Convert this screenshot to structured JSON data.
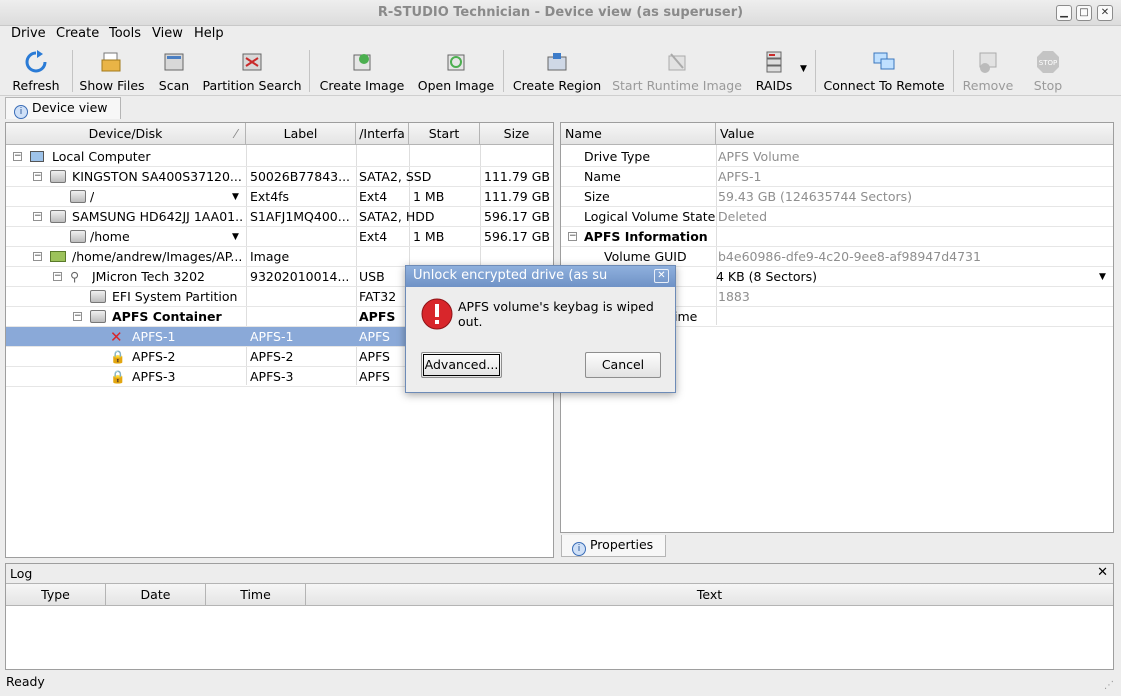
{
  "window": {
    "title": "R-STUDIO Technician - Device view (as superuser)"
  },
  "menu": [
    "Drive",
    "Create",
    "Tools",
    "View",
    "Help"
  ],
  "toolbar": {
    "refresh": "Refresh",
    "show_files": "Show Files",
    "scan": "Scan",
    "partition_search": "Partition Search",
    "create_image": "Create Image",
    "open_image": "Open Image",
    "create_region": "Create Region",
    "start_runtime_image": "Start Runtime Image",
    "raids": "RAIDs",
    "connect_to_remote": "Connect To Remote",
    "remove": "Remove",
    "stop": "Stop"
  },
  "tabs": {
    "device_view": "Device view",
    "properties": "Properties"
  },
  "device_table": {
    "columns": [
      "Device/Disk",
      "Label",
      "/Interfa",
      "Start",
      "Size"
    ],
    "rows": [
      {
        "name": "Local Computer",
        "label": "",
        "iface": "",
        "start": "",
        "size": ""
      },
      {
        "name": "KINGSTON SA400S37120...",
        "label": "50026B77843...",
        "iface": "SATA2, SSD",
        "start": "",
        "size": "111.79 GB"
      },
      {
        "name": "/",
        "label": "Ext4fs",
        "iface": "Ext4",
        "start": "1 MB",
        "size": "111.79 GB"
      },
      {
        "name": "SAMSUNG HD642JJ 1AA01...",
        "label": "S1AFJ1MQ400...",
        "iface": "SATA2, HDD",
        "start": "",
        "size": "596.17 GB"
      },
      {
        "name": "/home",
        "label": "",
        "iface": "Ext4",
        "start": "1 MB",
        "size": "596.17 GB"
      },
      {
        "name": "/home/andrew/Images/AP...",
        "label": "Image",
        "iface": "",
        "start": "",
        "size": ""
      },
      {
        "name": "JMicron Tech 3202",
        "label": "93202010014...",
        "iface": "USB",
        "start": "",
        "size": ""
      },
      {
        "name": "EFI System Partition",
        "label": "",
        "iface": "FAT32",
        "start": "",
        "size": ""
      },
      {
        "name": "APFS Container",
        "label": "",
        "iface": "APFS",
        "start": "",
        "size": ""
      },
      {
        "name": "APFS-1",
        "label": "APFS-1",
        "iface": "APFS",
        "start": "",
        "size": ""
      },
      {
        "name": "APFS-2",
        "label": "APFS-2",
        "iface": "APFS",
        "start": "",
        "size": ""
      },
      {
        "name": "APFS-3",
        "label": "APFS-3",
        "iface": "APFS",
        "start": "",
        "size": ""
      }
    ]
  },
  "properties": {
    "columns": [
      "Name",
      "Value"
    ],
    "rows": [
      {
        "name": "Drive Type",
        "value": "APFS Volume"
      },
      {
        "name": "Name",
        "value": "APFS-1"
      },
      {
        "name": "Size",
        "value": "59.43 GB (124635744 Sectors)"
      },
      {
        "name": "Logical Volume State",
        "value": "Deleted"
      },
      {
        "name": "APFS Information",
        "value": ""
      },
      {
        "name": "Volume GUID",
        "value": "b4e60986-dfe9-4c20-9ee8-af98947d4731"
      },
      {
        "name": "",
        "value": "4 KB (8 Sectors)"
      },
      {
        "name": "",
        "value": "1883"
      },
      {
        "name": "ime",
        "value": ""
      }
    ]
  },
  "log": {
    "title": "Log",
    "columns": [
      "Type",
      "Date",
      "Time",
      "Text"
    ]
  },
  "status": "Ready",
  "dialog": {
    "title": "Unlock encrypted drive (as su",
    "message": "APFS volume's keybag is wiped out.",
    "advanced": "Advanced...",
    "cancel": "Cancel"
  },
  "colors": {
    "selection": "#8aa9d8",
    "dialog_title": "#7a9bcd",
    "error": "#d8262b"
  }
}
